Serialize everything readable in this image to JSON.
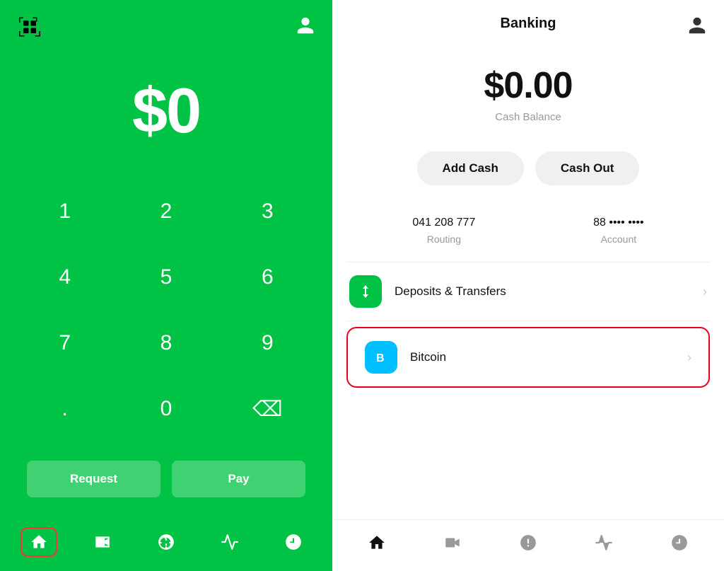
{
  "left": {
    "balance": "$0",
    "numpad": {
      "keys": [
        "1",
        "2",
        "3",
        "4",
        "5",
        "6",
        "7",
        "8",
        "9",
        ".",
        "0",
        "⌫"
      ]
    },
    "actions": {
      "request": "Request",
      "pay": "Pay"
    },
    "nav": {
      "items": [
        "home",
        "video",
        "dollar",
        "activity",
        "clock"
      ]
    }
  },
  "right": {
    "header": {
      "title": "Banking"
    },
    "balance": "$0.00",
    "balance_label": "Cash Balance",
    "buttons": {
      "add_cash": "Add Cash",
      "cash_out": "Cash Out"
    },
    "routing": {
      "value": "041 208 777",
      "label": "Routing"
    },
    "account": {
      "value": "88 •••• ••••",
      "label": "Account"
    },
    "menu_items": [
      {
        "id": "deposits",
        "label": "Deposits & Transfers",
        "icon_type": "green"
      },
      {
        "id": "bitcoin",
        "label": "Bitcoin",
        "icon_type": "blue"
      }
    ],
    "nav": {
      "items": [
        "home",
        "video",
        "dollar",
        "activity",
        "clock"
      ]
    }
  }
}
